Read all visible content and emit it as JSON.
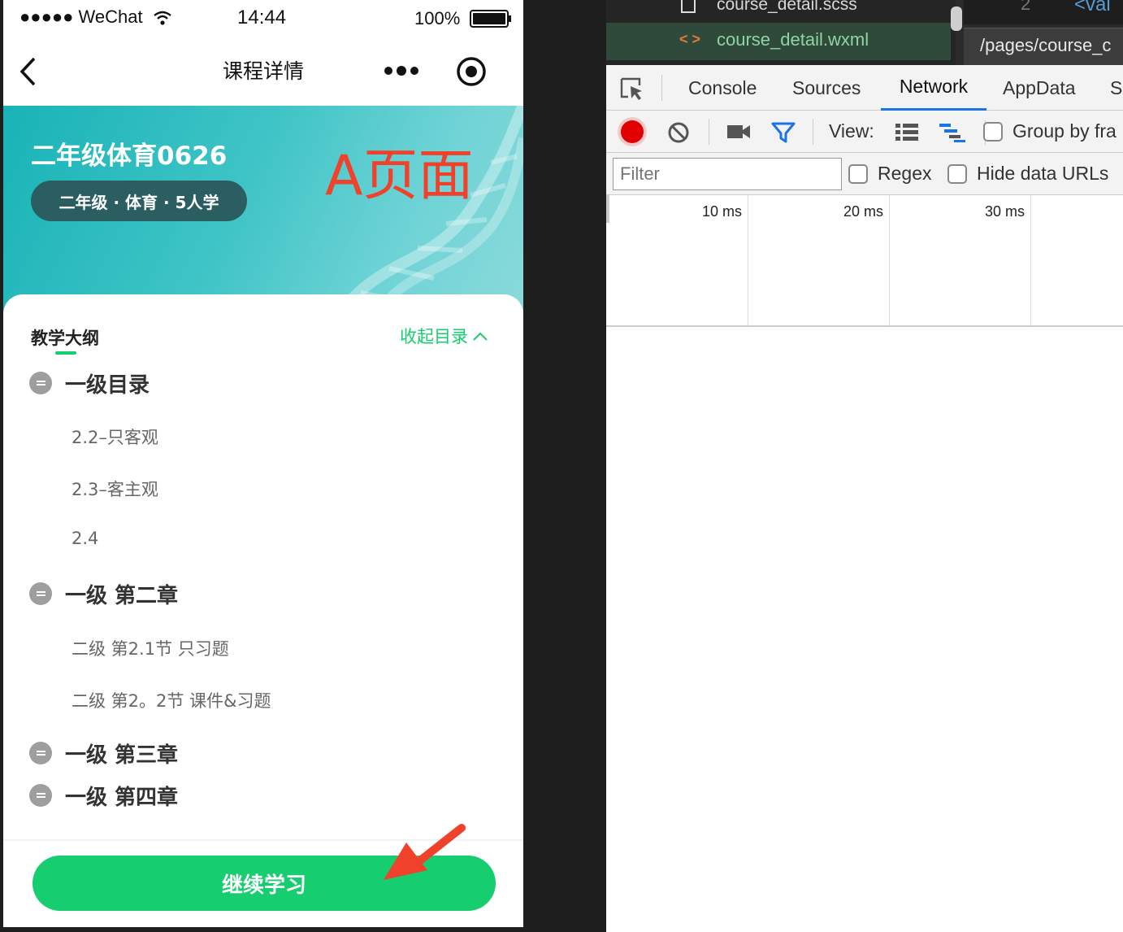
{
  "phone": {
    "status": {
      "signal": "●●●●● WeChat",
      "time": "14:44",
      "battery": "100%"
    },
    "nav": {
      "title": "课程详情",
      "more": "•••"
    },
    "banner": {
      "title": "二年级体育0626",
      "tag": "二年级 · 体育 · 5人学",
      "annotation": "A页面"
    },
    "outline": {
      "heading": "教学大纲",
      "collapse_label": "收起目录",
      "chapters": [
        {
          "title": "一级目录",
          "items": [
            "2.2–只客观",
            "2.3–客主观",
            "2.4"
          ]
        },
        {
          "title": "一级 第二章",
          "items": [
            "二级 第2.1节 只习题",
            "二级 第2。2节 课件&习题"
          ]
        },
        {
          "title": "一级 第三章",
          "items": []
        },
        {
          "title": "一级 第四章",
          "items": []
        }
      ]
    },
    "cta_label": "继续学习"
  },
  "editor": {
    "files": [
      "course_detail.scss",
      "course_detail.wxml"
    ],
    "file_icon": "< >",
    "line_number": "2",
    "code_fragment": "<vai",
    "breadcrumb": "/pages/course_c"
  },
  "devtools": {
    "tabs": [
      "Console",
      "Sources",
      "Network",
      "AppData",
      "S"
    ],
    "active_tab": "Network",
    "toolbar": {
      "view_label": "View:",
      "group_by_label": "Group by fra"
    },
    "filter": {
      "placeholder": "Filter",
      "regex_label": "Regex",
      "hide_data_urls_label": "Hide data URLs"
    },
    "timeline": [
      "10 ms",
      "20 ms",
      "30 ms"
    ]
  },
  "colors": {
    "accent_green": "#16cd6f",
    "annotation_red": "#f0412b",
    "banner_teal": "#2bbcbd",
    "record_red": "#e00000",
    "devtools_blue": "#1a73e8"
  }
}
